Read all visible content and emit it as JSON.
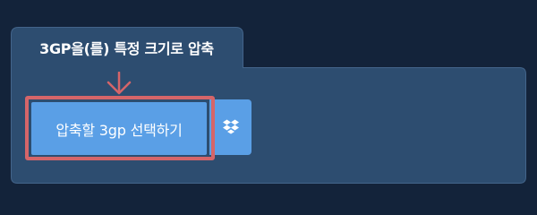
{
  "panel": {
    "title": "3GP을(를) 특정 크기로 압축"
  },
  "upload": {
    "select_label": "압축할 3gp 선택하기"
  },
  "icons": {
    "annotation": "arrow-down-icon",
    "cloud_source": "dropbox-icon"
  },
  "colors": {
    "page_background": "#13233a",
    "panel_background": "#2d4d70",
    "panel_border": "#43648a",
    "button": "#5a9fe6",
    "highlight": "#d56569",
    "text": "#ffffff"
  }
}
